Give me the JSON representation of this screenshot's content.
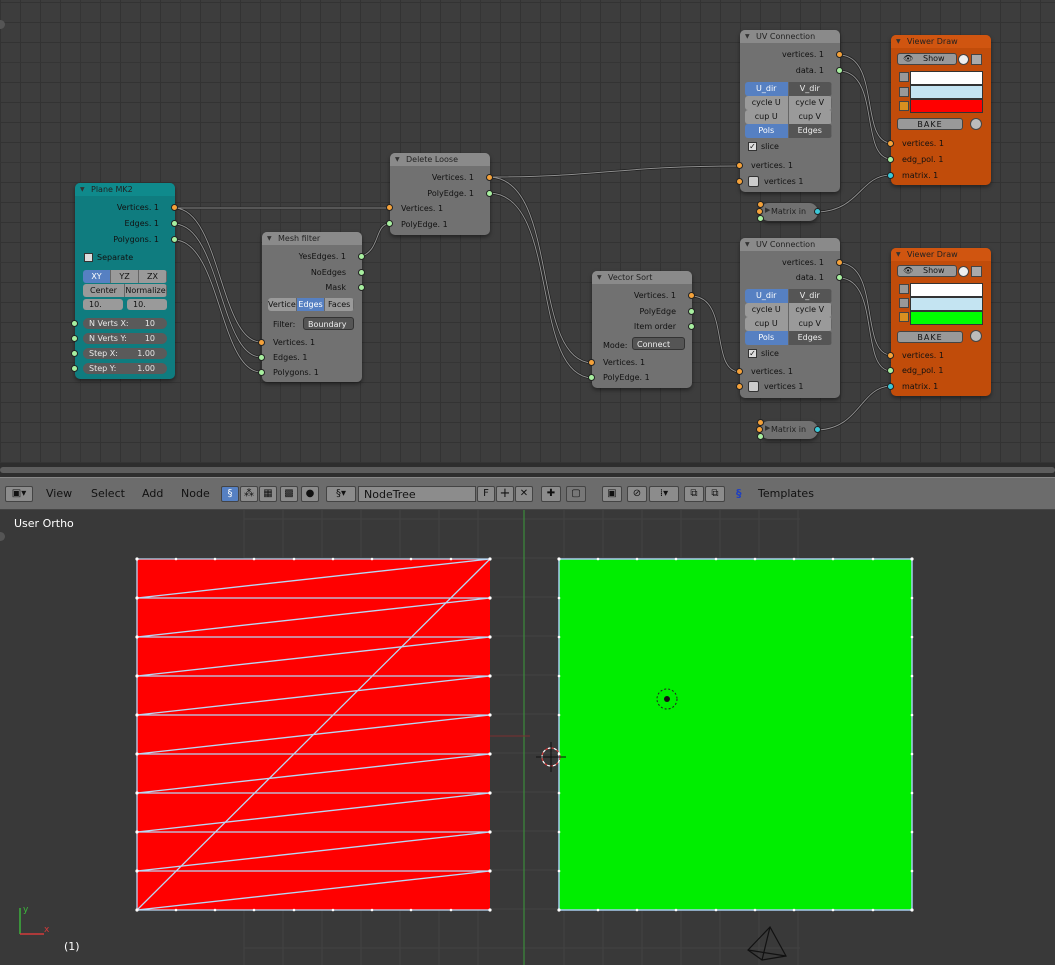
{
  "node_editor": {
    "nodes": {
      "plane": {
        "title": "Plane MK2",
        "outputs": [
          "Vertices. 1",
          "Edges. 1",
          "Polygons. 1"
        ],
        "separate_label": "Separate",
        "axis_buttons": [
          "XY",
          "YZ",
          "ZX"
        ],
        "mode_buttons": [
          "Center",
          "Normalize"
        ],
        "size_fields": [
          "10.",
          "10."
        ],
        "params": [
          {
            "label": "N Verts X:",
            "value": "10"
          },
          {
            "label": "N Verts Y:",
            "value": "10"
          },
          {
            "label": "Step X:",
            "value": "1.00"
          },
          {
            "label": "Step Y:",
            "value": "1.00"
          }
        ]
      },
      "mesh_filter": {
        "title": "Mesh filter",
        "outputs": [
          "YesEdges. 1",
          "NoEdges",
          "Mask"
        ],
        "type_buttons": [
          "Vertice",
          "Edges",
          "Faces"
        ],
        "filter_label": "Filter:",
        "filter_value": "Boundary",
        "inputs": [
          "Vertices. 1",
          "Edges. 1",
          "Polygons. 1"
        ]
      },
      "delete_loose": {
        "title": "Delete Loose",
        "outputs": [
          "Vertices. 1",
          "PolyEdge. 1"
        ],
        "inputs": [
          "Vertices. 1",
          "PolyEdge. 1"
        ]
      },
      "vector_sort": {
        "title": "Vector Sort",
        "outputs": [
          "Vertices. 1",
          "PolyEdge",
          "Item order"
        ],
        "mode_label": "Mode:",
        "mode_value": "Connect",
        "inputs": [
          "Vertices. 1",
          "PolyEdge. 1"
        ]
      },
      "uv_top": {
        "title": "UV Connection",
        "outputs": [
          "vertices. 1",
          "data. 1"
        ],
        "grid": [
          [
            "U_dir",
            "V_dir"
          ],
          [
            "cycle U",
            "cycle V"
          ],
          [
            "cup U",
            "cup V"
          ],
          [
            "Pols",
            "Edges"
          ]
        ],
        "slice_label": "slice",
        "inputs": [
          "vertices. 1",
          "vertices 1"
        ]
      },
      "uv_bottom": {
        "title": "UV Connection",
        "outputs": [
          "vertices. 1",
          "data. 1"
        ],
        "grid": [
          [
            "U_dir",
            "V_dir"
          ],
          [
            "cycle U",
            "cycle V"
          ],
          [
            "cup U",
            "cup V"
          ],
          [
            "Pols",
            "Edges"
          ]
        ],
        "slice_label": "slice",
        "inputs": [
          "vertices. 1",
          "vertices 1"
        ]
      },
      "viewer_top": {
        "title": "Viewer Draw",
        "show_label": "Show",
        "bake_label": "BAKE",
        "colors": [
          "#ffffff",
          "#c4e4f2",
          "#ff0000"
        ],
        "inputs": [
          "vertices. 1",
          "edg_pol. 1",
          "matrix. 1"
        ]
      },
      "viewer_bottom": {
        "title": "Viewer Draw",
        "show_label": "Show",
        "bake_label": "BAKE",
        "colors": [
          "#ffffff",
          "#c4e4f2",
          "#00ff00"
        ],
        "inputs": [
          "vertices. 1",
          "edg_pol. 1",
          "matrix. 1"
        ]
      },
      "matrix_top": {
        "title": "Matrix in"
      },
      "matrix_bottom": {
        "title": "Matrix in"
      }
    }
  },
  "toolbar": {
    "menus": [
      "View",
      "Select",
      "Add",
      "Node"
    ],
    "tree_name": "NodeTree",
    "fake_user": "F",
    "templates_label": "Templates"
  },
  "viewport": {
    "view_label": "User Ortho",
    "frame_label": "(1)",
    "colors": {
      "red_mesh": "#ff0000",
      "green_mesh": "#00ff00",
      "edge": "#a8cdf0",
      "y_axis": "#3c8c3c"
    }
  }
}
